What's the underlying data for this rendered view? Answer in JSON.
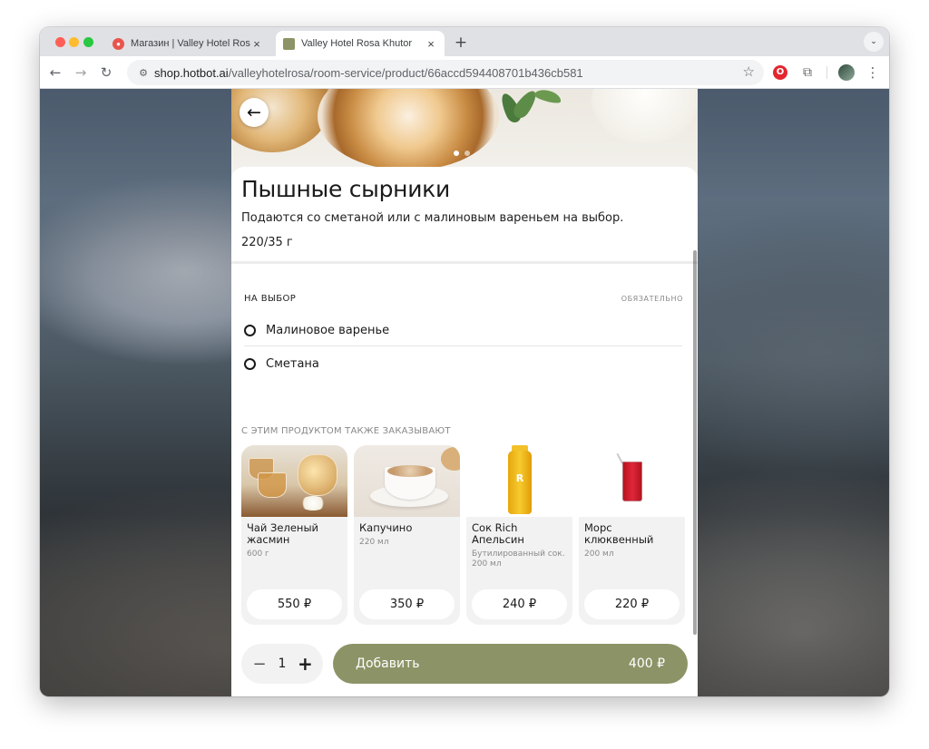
{
  "browser": {
    "tabs": [
      {
        "title": "Магазин | Valley Hotel Rosa K",
        "active": false
      },
      {
        "title": "Valley Hotel Rosa Khutor",
        "active": true
      }
    ],
    "url_host": "shop.hotbot.ai",
    "url_path": "/valleyhotelrosa/room-service/product/66accd594408701b436cb581",
    "nav": {
      "back": "←",
      "forward": "→",
      "reload": "↻",
      "new_tab": "+",
      "tab_menu": "⌄",
      "star": "☆",
      "more": "⋮",
      "site_info": "⚙"
    }
  },
  "product": {
    "back_icon": "←",
    "title": "Пышные сырники",
    "description": "Подаются со сметаной или с малиновым вареньем на выбор.",
    "weight": "220/35 г"
  },
  "options": {
    "label": "НА ВЫБОР",
    "required": "ОБЯЗАТЕЛЬНО",
    "items": [
      "Малиновое варенье",
      "Сметана"
    ]
  },
  "also_ordered": {
    "title": "С ЭТИМ ПРОДУКТОМ ТАКЖЕ ЗАКАЗЫВАЮТ",
    "items": [
      {
        "name": "Чай Зеленый жасмин",
        "meta": "600 г",
        "price": "550 ₽"
      },
      {
        "name": "Капучино",
        "meta": "220 мл",
        "price": "350 ₽"
      },
      {
        "name": "Сок Rich Апельсин",
        "meta": "Бутилированный сок. 200 мл",
        "price": "240 ₽"
      },
      {
        "name": "Морс клюквенный",
        "meta": "200 мл",
        "price": "220 ₽"
      }
    ]
  },
  "cart": {
    "minus": "−",
    "quantity": "1",
    "plus": "+",
    "add_label": "Добавить",
    "total": "400 ₽"
  },
  "colors": {
    "accent": "#8c9467"
  }
}
